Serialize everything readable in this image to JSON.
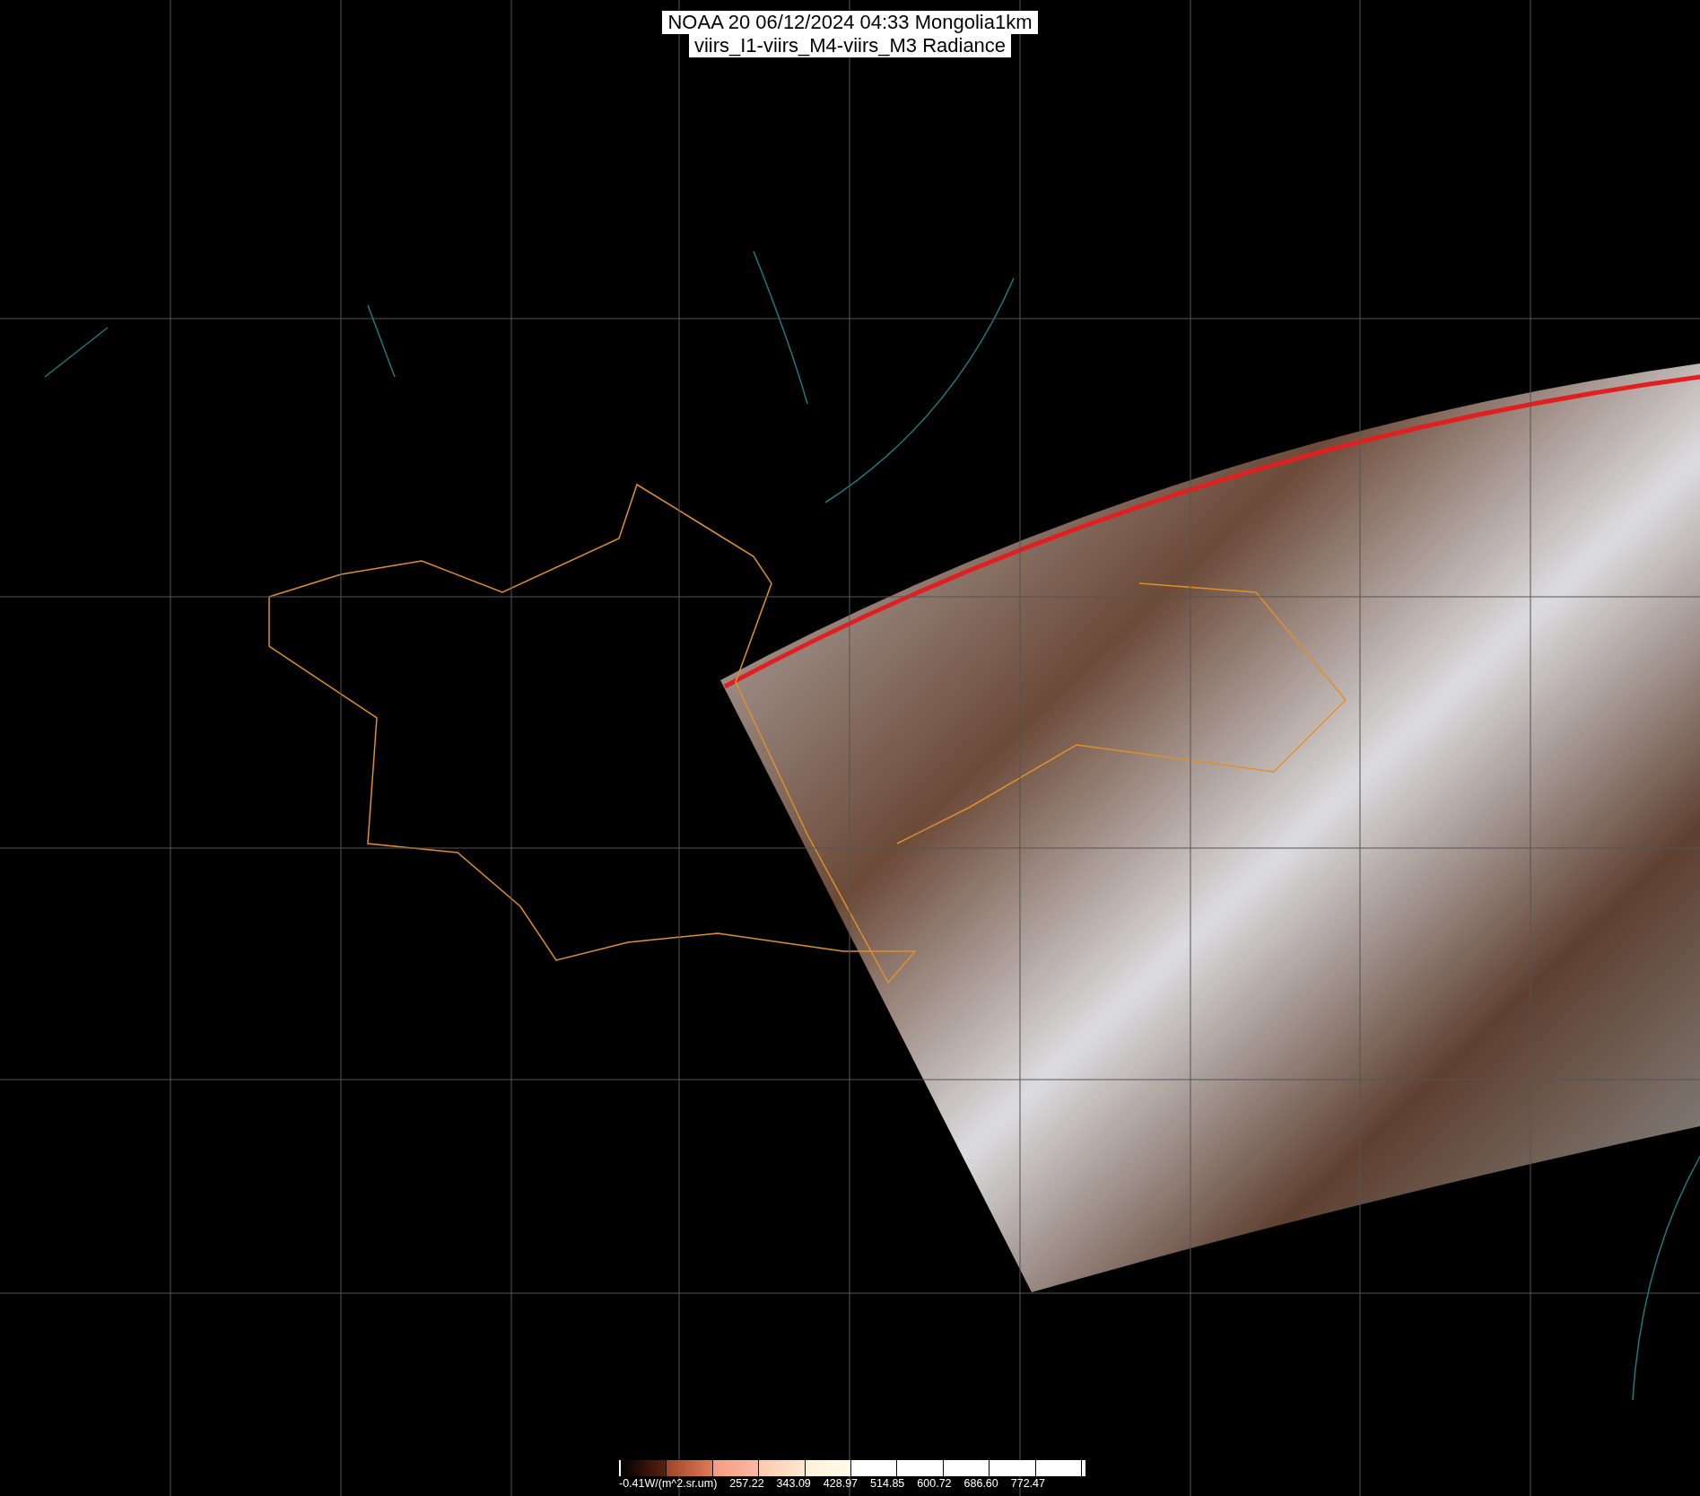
{
  "title": {
    "lines": [
      "NOAA 20 06/12/2024 04:33 Mongolia1km",
      "viirs_I1-viirs_M4-viirs_M3 Radiance"
    ]
  },
  "colorbar": {
    "labels": [
      "-0.41W/(m^2.sr.um)",
      "257.22",
      "343.09",
      "428.97",
      "514.85",
      "600.72",
      "686.60",
      "772.47"
    ]
  }
}
